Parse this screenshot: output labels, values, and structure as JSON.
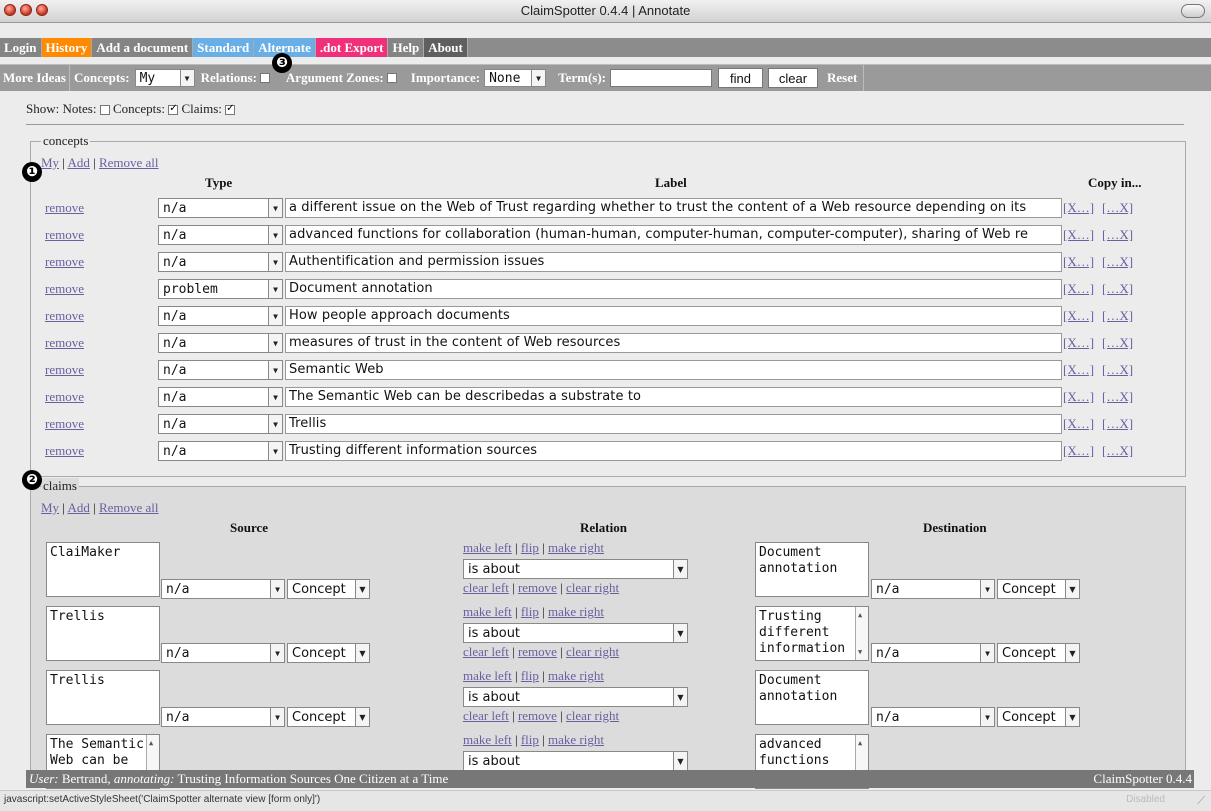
{
  "window": {
    "title": "ClaimSpotter 0.4.4 | Annotate"
  },
  "nav": {
    "items": [
      {
        "label": "Login",
        "style": "plain"
      },
      {
        "label": "History",
        "style": "orange"
      },
      {
        "label": "Add a document",
        "style": "plain"
      },
      {
        "label": "Standard",
        "style": "blue"
      },
      {
        "label": "Alternate",
        "style": "blue"
      },
      {
        "label": ".dot Export",
        "style": "pink"
      },
      {
        "label": "Help",
        "style": "plain"
      },
      {
        "label": "About",
        "style": "dark"
      }
    ]
  },
  "toolbar": {
    "more_ideas": "More Ideas",
    "concepts_label": "Concepts:",
    "concepts_value": "My",
    "relations_label": "Relations:",
    "argument_zones_label": "Argument Zones:",
    "importance_label": "Importance:",
    "importance_value": "None",
    "terms_label": "Term(s):",
    "terms_value": "",
    "find_label": "find",
    "clear_label": "clear",
    "reset_label": "Reset"
  },
  "show": {
    "label": "Show:",
    "notes_label": "Notes:",
    "concepts_label": "Concepts:",
    "claims_label": "Claims:",
    "notes_checked": false,
    "concepts_checked": true,
    "claims_checked": true
  },
  "concepts": {
    "legend": "concepts",
    "links": {
      "my": "My",
      "add": "Add",
      "remove_all": "Remove all",
      "sep": "|"
    },
    "headers": {
      "type": "Type",
      "label": "Label",
      "copy_in": "Copy in..."
    },
    "remove_label": "remove",
    "copy_links": [
      "[X…]",
      "[…X]"
    ],
    "rows": [
      {
        "type": "n/a",
        "label": "a different issue on the Web of Trust regarding whether to trust the  content of a Web resource depending on its"
      },
      {
        "type": "n/a",
        "label": "advanced functions for collaboration (human-human, computer-human, computer-computer), sharing of Web re"
      },
      {
        "type": "n/a",
        "label": "Authentification and permission issues"
      },
      {
        "type": "problem",
        "label": "Document annotation"
      },
      {
        "type": "n/a",
        "label": "How people approach documents"
      },
      {
        "type": "n/a",
        "label": "measures of trust in the content of Web resources"
      },
      {
        "type": "n/a",
        "label": "Semantic Web"
      },
      {
        "type": "n/a",
        "label": "The Semantic Web can be describedas a substrate to"
      },
      {
        "type": "n/a",
        "label": "Trellis"
      },
      {
        "type": "n/a",
        "label": "Trusting different information sources"
      }
    ]
  },
  "claims": {
    "legend": "claims",
    "links": {
      "my": "My",
      "add": "Add",
      "remove_all": "Remove all",
      "sep": "|"
    },
    "headers": {
      "source": "Source",
      "relation": "Relation",
      "destination": "Destination"
    },
    "top_links": {
      "make_left": "make left",
      "flip": "flip",
      "make_right": "make right"
    },
    "bottom_links": {
      "clear_left": "clear left",
      "remove": "remove",
      "clear_right": "clear right"
    },
    "rows": [
      {
        "source": "ClaiMaker",
        "source_type": "n/a",
        "source_kind": "Concept",
        "relation": "is about",
        "dest": "Document\nannotation",
        "dest_type": "n/a",
        "dest_kind": "Concept"
      },
      {
        "source": "Trellis",
        "source_type": "n/a",
        "source_kind": "Concept",
        "relation": "is about",
        "dest": "Trusting\ndifferent\ninformation",
        "dest_type": "n/a",
        "dest_kind": "Concept"
      },
      {
        "source": "Trellis",
        "source_type": "n/a",
        "source_kind": "Concept",
        "relation": "is about",
        "dest": "Document\nannotation",
        "dest_type": "n/a",
        "dest_kind": "Concept"
      },
      {
        "source": "The Semantic\nWeb can be",
        "source_type": "",
        "source_kind": "",
        "relation": "is about",
        "dest": "advanced\nfunctions",
        "dest_type": "",
        "dest_kind": ""
      }
    ]
  },
  "status": {
    "user_label": "User:",
    "user_name": " Bertrand, ",
    "annotating_label": "annotating:",
    "document": " Trusting Information Sources One Citizen at a Time",
    "version": "ClaimSpotter 0.4.4"
  },
  "bottom": {
    "status_text": "javascript:setActiveStyleSheet('ClaimSpotter alternate view [form only]')",
    "disabled_label": "Disabled"
  },
  "badges": [
    "❶",
    "❷",
    "❸"
  ]
}
